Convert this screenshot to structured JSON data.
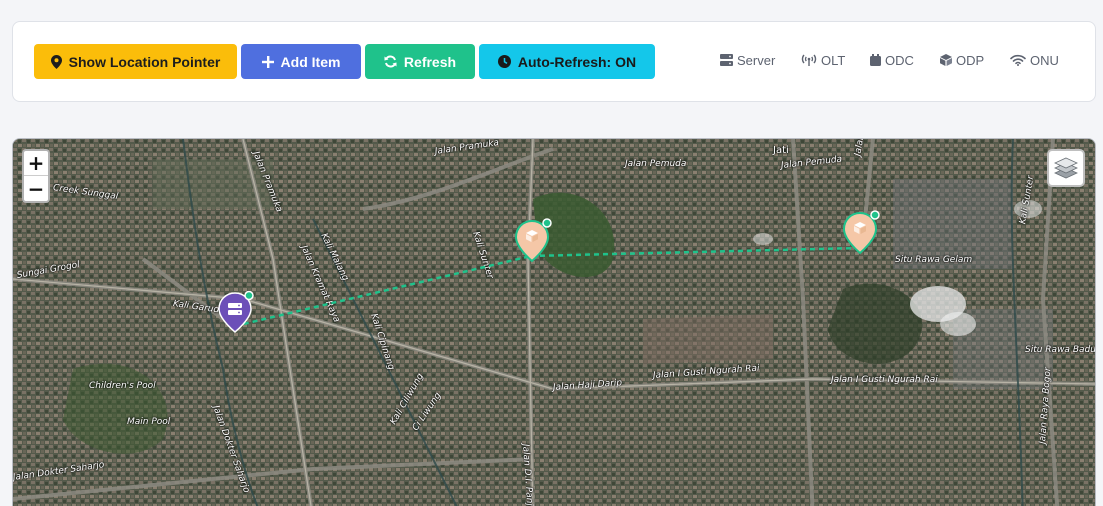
{
  "toolbar": {
    "show_location_label": "Show Location Pointer",
    "add_item_label": "Add Item",
    "refresh_label": "Refresh",
    "auto_refresh_label": "Auto-Refresh: ON",
    "colors": {
      "show_location": "#fbbd0a",
      "add_item": "#4f6fdf",
      "refresh": "#1fc28b",
      "auto_refresh": "#14c7ea"
    }
  },
  "legend": {
    "items": [
      {
        "label": "Server",
        "icon": "server-icon"
      },
      {
        "label": "OLT",
        "icon": "antenna-icon"
      },
      {
        "label": "ODC",
        "icon": "cabinet-icon"
      },
      {
        "label": "ODP",
        "icon": "cube-icon"
      },
      {
        "label": "ONU",
        "icon": "wifi-icon"
      }
    ]
  },
  "map": {
    "zoom_in": "+",
    "zoom_out": "−",
    "link_color": "#1fc28b",
    "labels": [
      "Jalan Pramuka",
      "Jalan Pemuda",
      "Jati",
      "Jalan Pemuda",
      "Jalan Pemuda",
      "Kali Sunter",
      "Jalan Pramuka",
      "Kali Malang",
      "Creek Sunggal",
      "Kali Cipinang",
      "Sungai Grogol",
      "Kali Garuda",
      "Jalan Kramat Raya",
      "Kali Ciliwung",
      "Jalan Haji Darip",
      "Jalan I Gusti Ngurah Rai",
      "Jalan I Gusti Ngurah Rai",
      "Situ Rawa Gelam",
      "Situ Rawa Badung",
      "Children's Pool",
      "Main Pool",
      "Jalan Dokter Saharjo",
      "Jalan D.I. Panjaitan",
      "Ci Liwung",
      "Kali Sunter",
      "Jalan Raya Bogor",
      "Jalan Dokter Saharjo"
    ],
    "markers": [
      {
        "type": "server",
        "icon": "server-icon",
        "color": "#6c4fb8"
      },
      {
        "type": "odp",
        "icon": "cube-icon",
        "color": "#f5c7a7"
      },
      {
        "type": "odp",
        "icon": "cube-icon",
        "color": "#f5c7a7"
      }
    ]
  }
}
